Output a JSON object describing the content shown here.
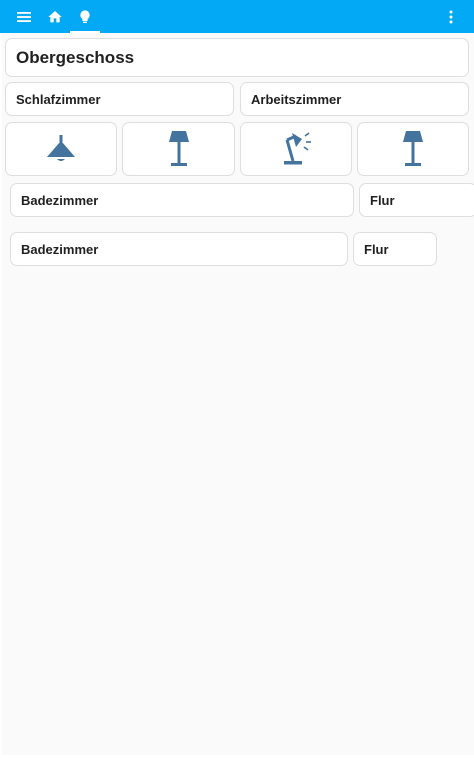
{
  "app": {
    "accent_color": "#03a9f4",
    "icon_color": "#44739e"
  },
  "toolbar": {
    "menu_icon": "menu-icon",
    "home_icon": "home-icon",
    "lights_icon": "lightbulb-icon",
    "overflow_icon": "dots-vertical-icon"
  },
  "main": {
    "title": "Obergeschoss",
    "rooms": {
      "schlafzimmer": "Schlafzimmer",
      "arbeitszimmer": "Arbeitszimmer"
    },
    "lamps": [
      "ceiling-light-icon",
      "floor-lamp-icon",
      "desk-lamp-icon",
      "floor-lamp-icon"
    ],
    "row1": {
      "bad": "Badezimmer",
      "flur": "Flur"
    },
    "row2": {
      "bad": "Badezimmer",
      "flur": "Flur"
    }
  }
}
